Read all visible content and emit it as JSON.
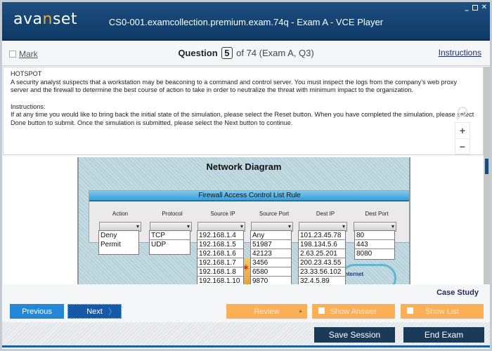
{
  "header": {
    "logo_pre": "ava",
    "logo_n": "n",
    "logo_post": "set",
    "title": "CS0-001.examcollection.premium.exam.74q - Exam A - VCE Player",
    "window_controls": {
      "minimize": "_",
      "close": "✕"
    }
  },
  "question_bar": {
    "mark_label": "Mark",
    "question_label": "Question",
    "question_number": "5",
    "question_rest": "of 74 (Exam A, Q3)",
    "instructions_link": "Instructions"
  },
  "question": {
    "type": "HOTSPOT",
    "body": "A security analyst suspects that a workstation may be beaconing to a command and control server. You must inspect the logs from the company's web proxy server and the firewall to determine the best course of action to take in order to neutralize the threat with minimum impact to the organization.",
    "instructions_heading": "Instructions:",
    "instructions_body": "If at any time you would like to bring back the initial state of the simulation, please select the Reset button. When you have completed the simulation, please select Done button to submit. Once the simulation is submitted, please select the Next button to continue."
  },
  "zoom_controls": {
    "plus": "+",
    "minus": "−"
  },
  "diagram": {
    "title": "Network Diagram",
    "acl_title": "Firewall Access Control List Rule",
    "columns": {
      "action": {
        "label": "Action",
        "options": [
          "Deny",
          "Permit"
        ]
      },
      "protocol": {
        "label": "Protocol",
        "options": [
          "TCP",
          "UDP"
        ]
      },
      "source_ip": {
        "label": "Source IP",
        "options": [
          "192.168.1.4",
          "192.168.1.5",
          "192.168.1.6",
          "192.168.1.7",
          "192.168.1.8",
          "192.168.1.10"
        ]
      },
      "source_port": {
        "label": "Source Port",
        "options": [
          "Any",
          "51987",
          "42123",
          "3456",
          "6580",
          "9870"
        ]
      },
      "dest_ip": {
        "label": "Dest IP",
        "options": [
          "101.23.45.78",
          "198.134.5.6",
          "2.63.25.201",
          "200.23.43.55",
          "23.33.56.102",
          "32.4.5.89"
        ]
      },
      "dest_port": {
        "label": "Dest Port",
        "options": [
          "80",
          "443",
          "8080"
        ]
      }
    },
    "internet_label": "nternet"
  },
  "nav": {
    "case_study": "Case Study",
    "previous": "Previous",
    "next": "Next",
    "review": "Review",
    "show_answer": "Show Answer",
    "show_list": "Show List"
  },
  "footer": {
    "save_session": "Save Session",
    "end_exam": "End Exam"
  },
  "colors": {
    "header_bg": "#174674",
    "accent_orange": "#fbaf57",
    "prev_blue": "#2487d6",
    "next_blue": "#165aa6",
    "footer_button": "#1a3a5a"
  }
}
